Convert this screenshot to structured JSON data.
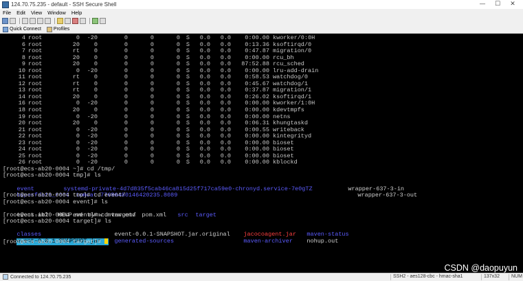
{
  "window": {
    "title": "124.70.75.235 - default - SSH Secure Shell",
    "controls": [
      "—",
      "☐",
      "✕"
    ]
  },
  "menu": [
    "File",
    "Edit",
    "View",
    "Window",
    "Help"
  ],
  "quickbar": {
    "quick_connect": "Quick Connect",
    "profiles": "Profiles"
  },
  "processes": [
    {
      "pid": "4",
      "user": "root",
      "pr": "0",
      "ni": "-20",
      "virt": "0",
      "res": "0",
      "shr": "0",
      "s": "S",
      "cpu": "0.0",
      "mem": "0.0",
      "time": "0:00.00",
      "cmd": "kworker/0:0H"
    },
    {
      "pid": "6",
      "user": "root",
      "pr": "20",
      "ni": "0",
      "virt": "0",
      "res": "0",
      "shr": "0",
      "s": "S",
      "cpu": "0.0",
      "mem": "0.0",
      "time": "0:13.36",
      "cmd": "ksoftirqd/0"
    },
    {
      "pid": "7",
      "user": "root",
      "pr": "rt",
      "ni": "0",
      "virt": "0",
      "res": "0",
      "shr": "0",
      "s": "S",
      "cpu": "0.0",
      "mem": "0.0",
      "time": "0:47.87",
      "cmd": "migration/0"
    },
    {
      "pid": "8",
      "user": "root",
      "pr": "20",
      "ni": "0",
      "virt": "0",
      "res": "0",
      "shr": "0",
      "s": "S",
      "cpu": "0.0",
      "mem": "0.0",
      "time": "0:00.00",
      "cmd": "rcu_bh"
    },
    {
      "pid": "9",
      "user": "root",
      "pr": "20",
      "ni": "0",
      "virt": "0",
      "res": "0",
      "shr": "0",
      "s": "S",
      "cpu": "0.0",
      "mem": "0.0",
      "time": "87:52.88",
      "cmd": "rcu_sched"
    },
    {
      "pid": "10",
      "user": "root",
      "pr": "0",
      "ni": "-20",
      "virt": "0",
      "res": "0",
      "shr": "0",
      "s": "S",
      "cpu": "0.0",
      "mem": "0.0",
      "time": "0:00.00",
      "cmd": "lru-add-drain"
    },
    {
      "pid": "11",
      "user": "root",
      "pr": "rt",
      "ni": "0",
      "virt": "0",
      "res": "0",
      "shr": "0",
      "s": "S",
      "cpu": "0.0",
      "mem": "0.0",
      "time": "0:58.53",
      "cmd": "watchdog/0"
    },
    {
      "pid": "12",
      "user": "root",
      "pr": "rt",
      "ni": "0",
      "virt": "0",
      "res": "0",
      "shr": "0",
      "s": "S",
      "cpu": "0.0",
      "mem": "0.0",
      "time": "0:45.67",
      "cmd": "watchdog/1"
    },
    {
      "pid": "13",
      "user": "root",
      "pr": "rt",
      "ni": "0",
      "virt": "0",
      "res": "0",
      "shr": "0",
      "s": "S",
      "cpu": "0.0",
      "mem": "0.0",
      "time": "0:37.87",
      "cmd": "migration/1"
    },
    {
      "pid": "14",
      "user": "root",
      "pr": "20",
      "ni": "0",
      "virt": "0",
      "res": "0",
      "shr": "0",
      "s": "S",
      "cpu": "0.0",
      "mem": "0.0",
      "time": "0:26.02",
      "cmd": "ksoftirqd/1"
    },
    {
      "pid": "16",
      "user": "root",
      "pr": "0",
      "ni": "-20",
      "virt": "0",
      "res": "0",
      "shr": "0",
      "s": "S",
      "cpu": "0.0",
      "mem": "0.0",
      "time": "0:00.00",
      "cmd": "kworker/1:0H"
    },
    {
      "pid": "18",
      "user": "root",
      "pr": "20",
      "ni": "0",
      "virt": "0",
      "res": "0",
      "shr": "0",
      "s": "S",
      "cpu": "0.0",
      "mem": "0.0",
      "time": "0:00.00",
      "cmd": "kdevtmpfs"
    },
    {
      "pid": "19",
      "user": "root",
      "pr": "0",
      "ni": "-20",
      "virt": "0",
      "res": "0",
      "shr": "0",
      "s": "S",
      "cpu": "0.0",
      "mem": "0.0",
      "time": "0:00.00",
      "cmd": "netns"
    },
    {
      "pid": "20",
      "user": "root",
      "pr": "20",
      "ni": "0",
      "virt": "0",
      "res": "0",
      "shr": "0",
      "s": "S",
      "cpu": "0.0",
      "mem": "0.0",
      "time": "0:06.31",
      "cmd": "khungtaskd"
    },
    {
      "pid": "21",
      "user": "root",
      "pr": "0",
      "ni": "-20",
      "virt": "0",
      "res": "0",
      "shr": "0",
      "s": "S",
      "cpu": "0.0",
      "mem": "0.0",
      "time": "0:00.55",
      "cmd": "writeback"
    },
    {
      "pid": "22",
      "user": "root",
      "pr": "0",
      "ni": "-20",
      "virt": "0",
      "res": "0",
      "shr": "0",
      "s": "S",
      "cpu": "0.0",
      "mem": "0.0",
      "time": "0:00.00",
      "cmd": "kintegrityd"
    },
    {
      "pid": "23",
      "user": "root",
      "pr": "0",
      "ni": "-20",
      "virt": "0",
      "res": "0",
      "shr": "0",
      "s": "S",
      "cpu": "0.0",
      "mem": "0.0",
      "time": "0:00.00",
      "cmd": "bioset"
    },
    {
      "pid": "24",
      "user": "root",
      "pr": "0",
      "ni": "-20",
      "virt": "0",
      "res": "0",
      "shr": "0",
      "s": "S",
      "cpu": "0.0",
      "mem": "0.0",
      "time": "0:00.00",
      "cmd": "bioset"
    },
    {
      "pid": "25",
      "user": "root",
      "pr": "0",
      "ni": "-20",
      "virt": "0",
      "res": "0",
      "shr": "0",
      "s": "S",
      "cpu": "0.0",
      "mem": "0.0",
      "time": "0:00.00",
      "cmd": "bioset"
    },
    {
      "pid": "26",
      "user": "root",
      "pr": "0",
      "ni": "-20",
      "virt": "0",
      "res": "0",
      "shr": "0",
      "s": "S",
      "cpu": "0.0",
      "mem": "0.0",
      "time": "0:00.00",
      "cmd": "kblockd"
    }
  ],
  "shell": {
    "cmd1": "[root@ecs-ab20-0004 ~]# cd /tmp/",
    "cmd2": "[root@ecs-ab20-0004 tmp]# ls",
    "tmp_ls1": [
      "event",
      "systemd-private-4d7d835f5cab46ca815d25f717ca59e0-chronyd.service-7e0gTZ",
      "wrapper-637-3-in"
    ],
    "tmp_ls2": [
      "hsperfdata_root",
      "tomcat.77686480146420235.8089",
      "wrapper-637-3-out"
    ],
    "cmd3": "[root@ecs-ab20-0004 tmp]# cd event/",
    "cmd4": "[root@ecs-ab20-0004 event]# ls",
    "event_ls": [
      "event.iml",
      "HELP.md",
      "mvnw",
      "mvnw.cmd",
      "pom.xml",
      "src",
      "target"
    ],
    "cmd5": "[root@ecs-ab20-0004 event]# cd target/",
    "cmd6": "[root@ecs-ab20-0004 target]# ls",
    "target_ls1": [
      "classes",
      "event-0.0.1-SNAPSHOT.jar.original",
      "jacocoagent.jar",
      "maven-status"
    ],
    "target_ls2": [
      "event-0.0.1-SNAPSHOT.jar",
      "generated-sources",
      "maven-archiver",
      "nohup.out"
    ],
    "cmd7": "[root@ecs-ab20-0004 target]# "
  },
  "status": {
    "connection": "Connected to 124.70.75.235",
    "protocol": "SSH2 - aes128-cbc - hmac-sha1",
    "size": "137x32",
    "extra": "NUM"
  },
  "watermark": "CSDN @daopuyun"
}
